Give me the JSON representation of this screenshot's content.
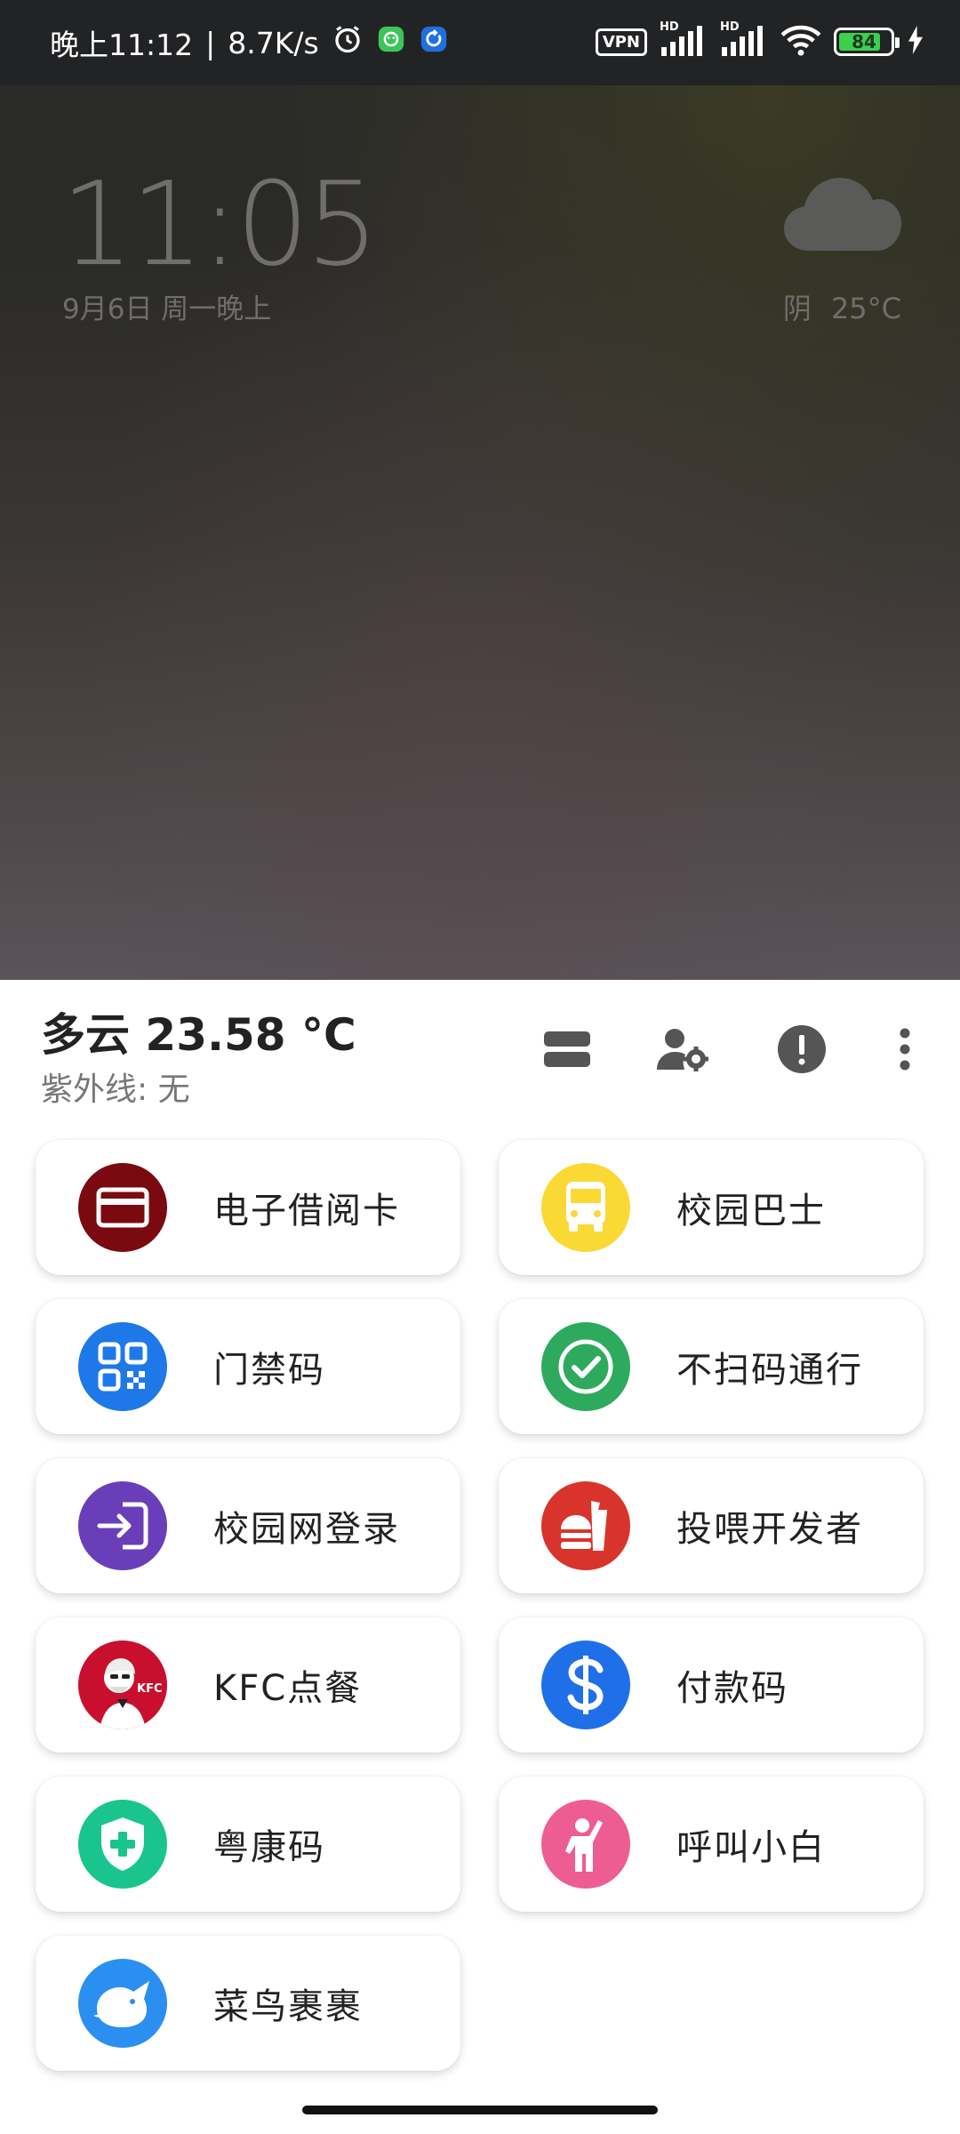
{
  "status_bar": {
    "time": "晚上11:12",
    "separator": "|",
    "net_speed": "8.7K/s",
    "vpn": "VPN",
    "hd1": "HD",
    "hd2": "HD",
    "battery": "84",
    "battery_level": 0.84,
    "icons": [
      "alarm-icon",
      "android-notification-icon",
      "sync-icon",
      "signal-icon",
      "wifi-icon",
      "charging-icon"
    ]
  },
  "lock_screen": {
    "time": "11:05",
    "date": "9月6日 周一晚上",
    "condition": "阴",
    "temperature": "25°C",
    "weather_icon": "cloud-icon"
  },
  "panel": {
    "weather": "多云 23.58 °C",
    "uv": "紫外线: 无",
    "toolbar_icons": [
      "dns-icon",
      "manage-account-icon",
      "alert-icon",
      "more-vert-icon"
    ]
  },
  "tiles": [
    {
      "label": "电子借阅卡",
      "icon": "credit-card-icon",
      "color": "#7a0a10"
    },
    {
      "label": "校园巴士",
      "icon": "bus-icon",
      "color": "#fbd935"
    },
    {
      "label": "门禁码",
      "icon": "qr-code-icon",
      "color": "#1f78e8"
    },
    {
      "label": "不扫码通行",
      "icon": "check-circle-icon",
      "color": "#2eaa5e"
    },
    {
      "label": "校园网登录",
      "icon": "login-icon",
      "color": "#6a3eb8"
    },
    {
      "label": "投喂开发者",
      "icon": "fastfood-icon",
      "color": "#d9342b"
    },
    {
      "label": "KFC点餐",
      "icon": "kfc-logo-icon",
      "color": "#c8102e"
    },
    {
      "label": "付款码",
      "icon": "dollar-icon",
      "color": "#1f6fe8"
    },
    {
      "label": "粤康码",
      "icon": "health-shield-icon",
      "color": "#19c58c"
    },
    {
      "label": "呼叫小白",
      "icon": "person-wave-icon",
      "color": "#ee5d91"
    },
    {
      "label": "菜鸟裹裹",
      "icon": "cainiao-bird-icon",
      "color": "#2a8ff0"
    }
  ]
}
